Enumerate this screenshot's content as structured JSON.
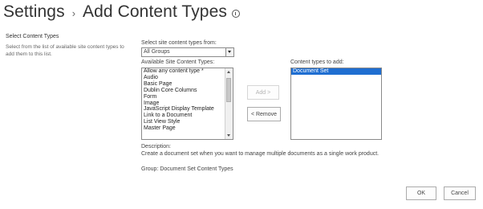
{
  "header": {
    "breadcrumb_root": "Settings",
    "separator": "›",
    "title": "Add Content Types"
  },
  "section": {
    "heading": "Select Content Types",
    "description": "Select from the list of available site content types to add them to this list."
  },
  "filter": {
    "label": "Select site content types from:",
    "selected": "All Groups"
  },
  "available": {
    "label": "Available Site Content Types:",
    "items": [
      "Allow any content type *",
      "Audio",
      "Basic Page",
      "Dublin Core Columns",
      "Form",
      "Image",
      "JavaScript Display Template",
      "Link to a Document",
      "List View Style",
      "Master Page"
    ]
  },
  "to_add": {
    "label": "Content types to add:",
    "items": [
      "Document Set"
    ]
  },
  "buttons": {
    "add": "Add >",
    "remove": "< Remove",
    "ok": "OK",
    "cancel": "Cancel"
  },
  "details": {
    "description_label": "Description:",
    "description_text": "Create a document set when you want to manage multiple documents as a single work product.",
    "group": "Group: Document Set Content Types"
  },
  "colors": {
    "selection": "#1f6ed1"
  }
}
